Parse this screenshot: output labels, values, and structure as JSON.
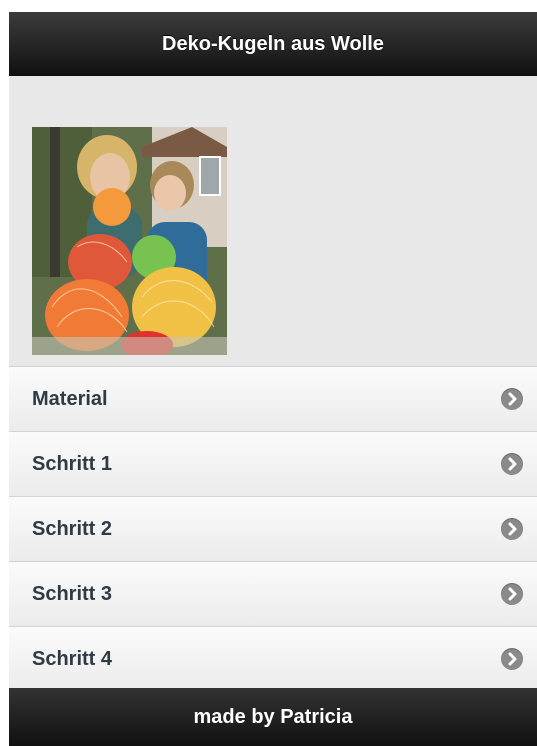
{
  "header": {
    "title": "Deko-Kugeln aus Wolle"
  },
  "image": {
    "icon": "photo-craft-balls"
  },
  "list": {
    "items": [
      {
        "label": "Material",
        "icon": "chevron-right-icon"
      },
      {
        "label": "Schritt 1",
        "icon": "chevron-right-icon"
      },
      {
        "label": "Schritt 2",
        "icon": "chevron-right-icon"
      },
      {
        "label": "Schritt 3",
        "icon": "chevron-right-icon"
      },
      {
        "label": "Schritt 4",
        "icon": "chevron-right-icon"
      }
    ]
  },
  "footer": {
    "text": "made by Patricia"
  },
  "colors": {
    "header_bg": "#1a1a1a",
    "list_text": "#2f3a44",
    "arrow_bg": "#8a8a8a",
    "content_bg": "#e8e8e8"
  }
}
